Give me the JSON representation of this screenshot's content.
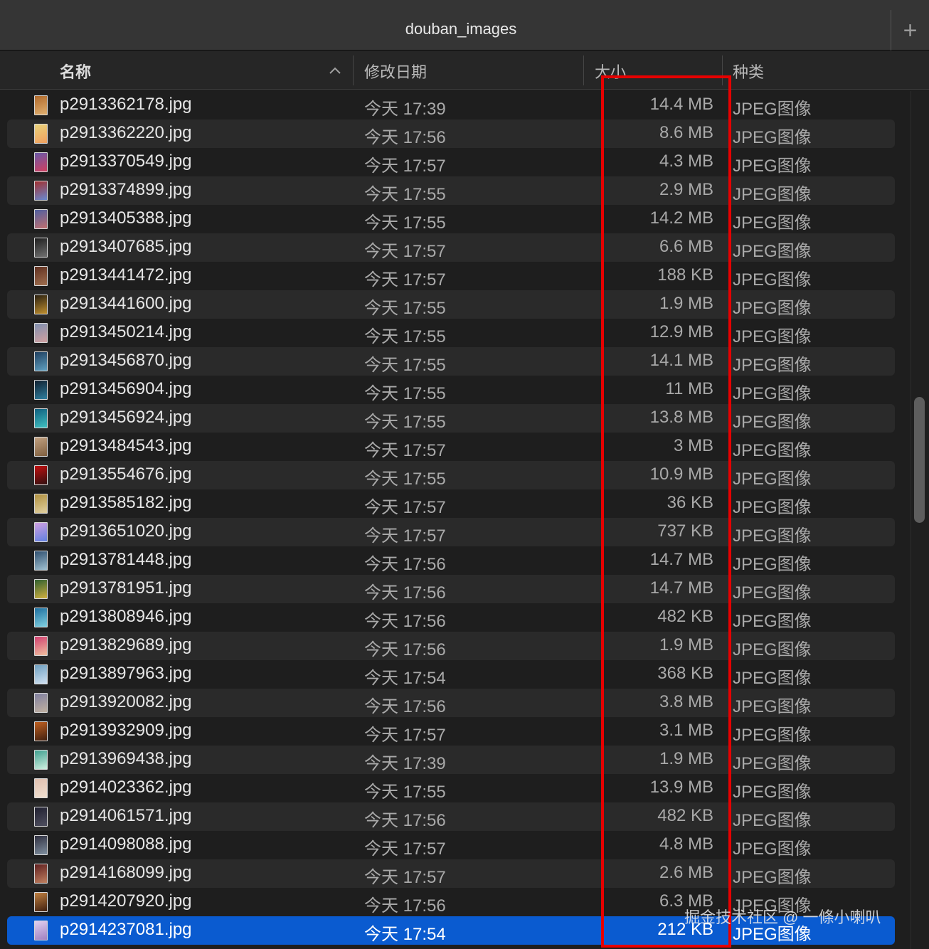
{
  "window": {
    "title": "douban_images",
    "new_tab_label": "+"
  },
  "columns": {
    "name": "名称",
    "date": "修改日期",
    "size": "大小",
    "kind": "种类"
  },
  "accent_color": "#0a5bd0",
  "annotation_color": "#e60000",
  "watermark": "掘金技术社区 @ 一條小喇叭",
  "files": [
    {
      "name": "p2913362178.jpg",
      "date": "今天 17:39",
      "size": "14.4 MB",
      "kind": "JPEG图像",
      "thumb": [
        "#b06a2c",
        "#e0b070"
      ]
    },
    {
      "name": "p2913362220.jpg",
      "date": "今天 17:56",
      "size": "8.6 MB",
      "kind": "JPEG图像",
      "thumb": [
        "#e8d27a",
        "#f0a060"
      ]
    },
    {
      "name": "p2913370549.jpg",
      "date": "今天 17:57",
      "size": "4.3 MB",
      "kind": "JPEG图像",
      "thumb": [
        "#6a5aa8",
        "#d04060"
      ]
    },
    {
      "name": "p2913374899.jpg",
      "date": "今天 17:55",
      "size": "2.9 MB",
      "kind": "JPEG图像",
      "thumb": [
        "#a03030",
        "#6a8ad0"
      ]
    },
    {
      "name": "p2913405388.jpg",
      "date": "今天 17:55",
      "size": "14.2 MB",
      "kind": "JPEG图像",
      "thumb": [
        "#5060a0",
        "#c07070"
      ]
    },
    {
      "name": "p2913407685.jpg",
      "date": "今天 17:57",
      "size": "6.6 MB",
      "kind": "JPEG图像",
      "thumb": [
        "#202020",
        "#707070"
      ]
    },
    {
      "name": "p2913441472.jpg",
      "date": "今天 17:57",
      "size": "188 KB",
      "kind": "JPEG图像",
      "thumb": [
        "#603020",
        "#a07050"
      ]
    },
    {
      "name": "p2913441600.jpg",
      "date": "今天 17:55",
      "size": "1.9 MB",
      "kind": "JPEG图像",
      "thumb": [
        "#2a2010",
        "#c09030"
      ]
    },
    {
      "name": "p2913450214.jpg",
      "date": "今天 17:55",
      "size": "12.9 MB",
      "kind": "JPEG图像",
      "thumb": [
        "#8090b0",
        "#d0a0a0"
      ]
    },
    {
      "name": "p2913456870.jpg",
      "date": "今天 17:55",
      "size": "14.1 MB",
      "kind": "JPEG图像",
      "thumb": [
        "#204060",
        "#60a0c0"
      ]
    },
    {
      "name": "p2913456904.jpg",
      "date": "今天 17:55",
      "size": "11 MB",
      "kind": "JPEG图像",
      "thumb": [
        "#102030",
        "#3080a0"
      ]
    },
    {
      "name": "p2913456924.jpg",
      "date": "今天 17:55",
      "size": "13.8 MB",
      "kind": "JPEG图像",
      "thumb": [
        "#106080",
        "#40c0c0"
      ]
    },
    {
      "name": "p2913484543.jpg",
      "date": "今天 17:57",
      "size": "3 MB",
      "kind": "JPEG图像",
      "thumb": [
        "#c0a080",
        "#806040"
      ]
    },
    {
      "name": "p2913554676.jpg",
      "date": "今天 17:55",
      "size": "10.9 MB",
      "kind": "JPEG图像",
      "thumb": [
        "#c01010",
        "#301010"
      ]
    },
    {
      "name": "p2913585182.jpg",
      "date": "今天 17:57",
      "size": "36 KB",
      "kind": "JPEG图像",
      "thumb": [
        "#b09040",
        "#e0d0a0"
      ]
    },
    {
      "name": "p2913651020.jpg",
      "date": "今天 17:57",
      "size": "737 KB",
      "kind": "JPEG图像",
      "thumb": [
        "#d0a0e0",
        "#6080e0"
      ]
    },
    {
      "name": "p2913781448.jpg",
      "date": "今天 17:56",
      "size": "14.7 MB",
      "kind": "JPEG图像",
      "thumb": [
        "#305070",
        "#a0c0d0"
      ]
    },
    {
      "name": "p2913781951.jpg",
      "date": "今天 17:56",
      "size": "14.7 MB",
      "kind": "JPEG图像",
      "thumb": [
        "#306030",
        "#d0b040"
      ]
    },
    {
      "name": "p2913808946.jpg",
      "date": "今天 17:56",
      "size": "482 KB",
      "kind": "JPEG图像",
      "thumb": [
        "#2070a0",
        "#80d0e0"
      ]
    },
    {
      "name": "p2913829689.jpg",
      "date": "今天 17:56",
      "size": "1.9 MB",
      "kind": "JPEG图像",
      "thumb": [
        "#d04070",
        "#f0c0a0"
      ]
    },
    {
      "name": "p2913897963.jpg",
      "date": "今天 17:54",
      "size": "368 KB",
      "kind": "JPEG图像",
      "thumb": [
        "#70a0c0",
        "#d0e0f0"
      ]
    },
    {
      "name": "p2913920082.jpg",
      "date": "今天 17:56",
      "size": "3.8 MB",
      "kind": "JPEG图像",
      "thumb": [
        "#8080a0",
        "#c0b0a0"
      ]
    },
    {
      "name": "p2913932909.jpg",
      "date": "今天 17:57",
      "size": "3.1 MB",
      "kind": "JPEG图像",
      "thumb": [
        "#c06020",
        "#402010"
      ]
    },
    {
      "name": "p2913969438.jpg",
      "date": "今天 17:39",
      "size": "1.9 MB",
      "kind": "JPEG图像",
      "thumb": [
        "#40a090",
        "#d0f0e0"
      ]
    },
    {
      "name": "p2914023362.jpg",
      "date": "今天 17:55",
      "size": "13.9 MB",
      "kind": "JPEG图像",
      "thumb": [
        "#e0c0b0",
        "#f0e0d0"
      ]
    },
    {
      "name": "p2914061571.jpg",
      "date": "今天 17:56",
      "size": "482 KB",
      "kind": "JPEG图像",
      "thumb": [
        "#202030",
        "#505060"
      ]
    },
    {
      "name": "p2914098088.jpg",
      "date": "今天 17:57",
      "size": "4.8 MB",
      "kind": "JPEG图像",
      "thumb": [
        "#303040",
        "#8090a0"
      ]
    },
    {
      "name": "p2914168099.jpg",
      "date": "今天 17:57",
      "size": "2.6 MB",
      "kind": "JPEG图像",
      "thumb": [
        "#602020",
        "#c08060"
      ]
    },
    {
      "name": "p2914207920.jpg",
      "date": "今天 17:56",
      "size": "6.3 MB",
      "kind": "JPEG图像",
      "thumb": [
        "#c08040",
        "#402010"
      ]
    },
    {
      "name": "p2914237081.jpg",
      "date": "今天 17:54",
      "size": "212 KB",
      "kind": "JPEG图像",
      "thumb": [
        "#e0d0f0",
        "#a080c0"
      ],
      "selected": true
    }
  ]
}
